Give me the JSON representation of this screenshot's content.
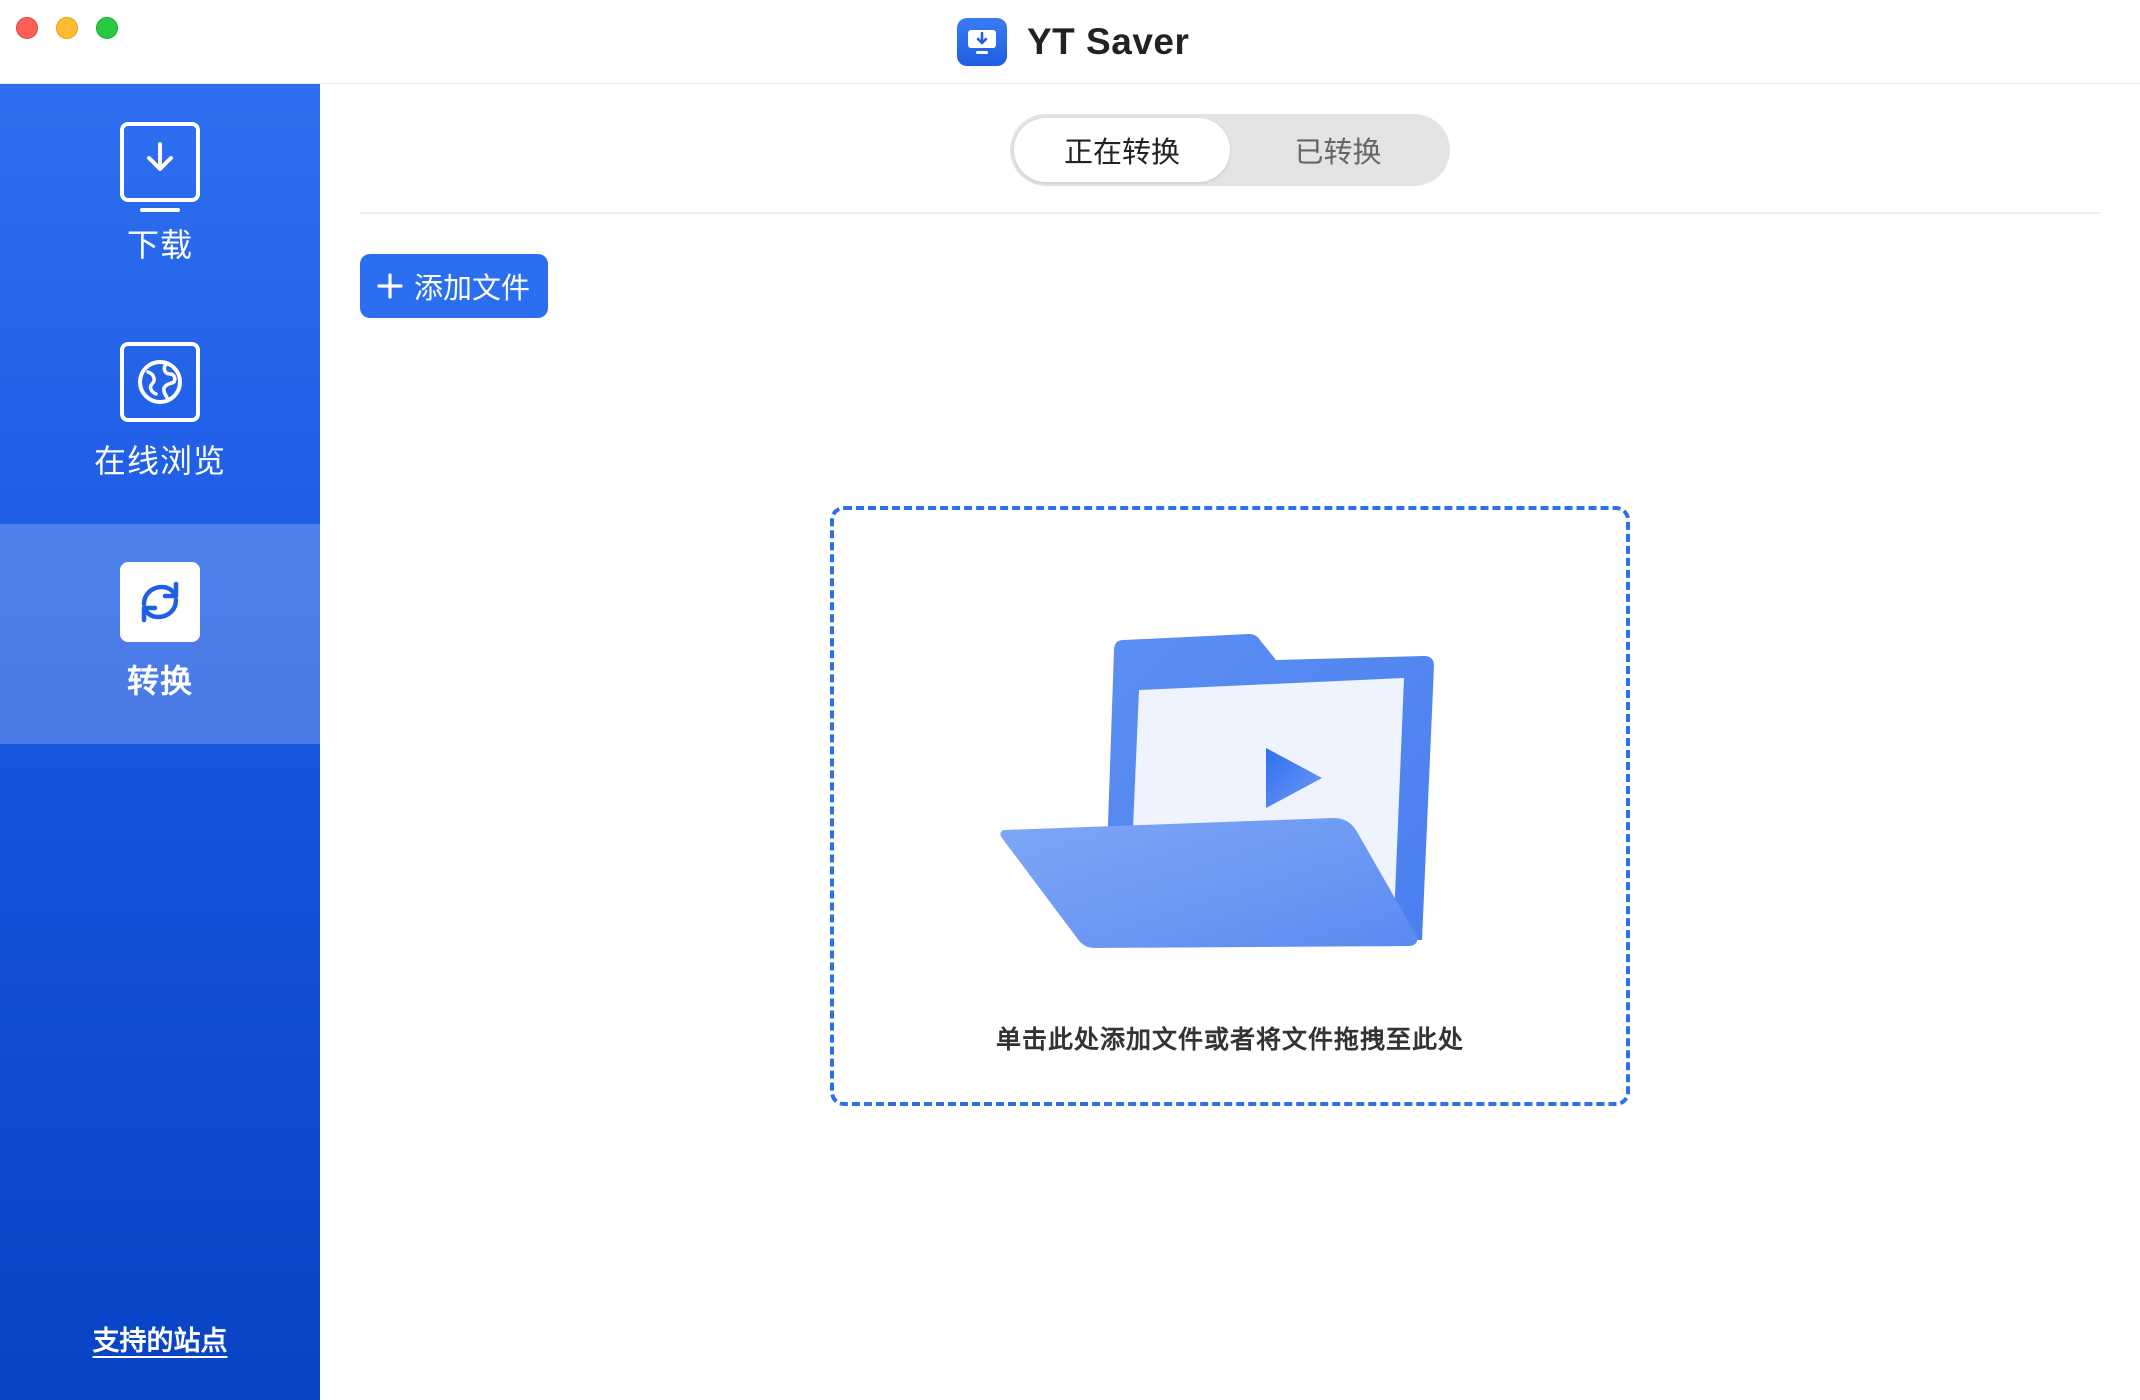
{
  "window": {
    "title": "YT Saver"
  },
  "sidebar": {
    "items": [
      {
        "label": "下载",
        "icon": "download-icon"
      },
      {
        "label": "在线浏览",
        "icon": "globe-icon"
      },
      {
        "label": "转换",
        "icon": "convert-icon",
        "active": true
      }
    ],
    "footer_link": "支持的站点"
  },
  "main": {
    "tabs": [
      {
        "label": "正在转换",
        "active": true
      },
      {
        "label": "已转换",
        "active": false
      }
    ],
    "add_button_label": "添加文件",
    "dropzone_hint": "单击此处添加文件或者将文件拖拽至此处"
  },
  "colors": {
    "accent": "#2b6ff0",
    "sidebar_top": "#2f6ff0",
    "sidebar_bottom": "#0843c4",
    "traffic_close": "#fe5f57",
    "traffic_minimize": "#febc2e",
    "traffic_maximize": "#28c840"
  }
}
